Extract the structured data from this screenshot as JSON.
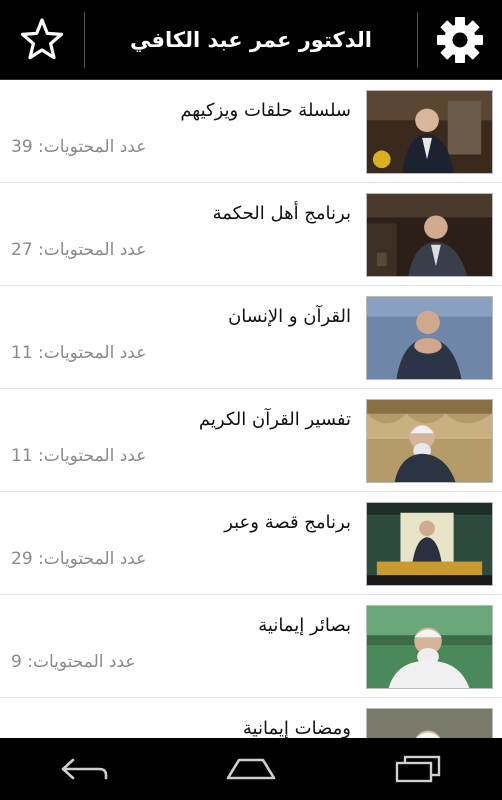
{
  "header": {
    "title": "الدكتور عمر عبد الكافي",
    "favorites_icon": "star-outline-icon",
    "settings_icon": "gear-icon"
  },
  "series": [
    {
      "title": "سلسلة حلقات ويزكيهم",
      "count_label": "عدد المحتويات: 39"
    },
    {
      "title": "برنامج أهل الحكمة",
      "count_label": "عدد المحتويات: 27"
    },
    {
      "title": "القرآن و الإنسان",
      "count_label": "عدد المحتويات: 11"
    },
    {
      "title": "تفسير القرآن الكريم",
      "count_label": "عدد المحتويات: 11"
    },
    {
      "title": "برنامج قصة وعبر",
      "count_label": "عدد المحتويات: 29"
    },
    {
      "title": "بصائر إيمانية",
      "count_label": "عدد المحتويات: 9"
    },
    {
      "title": "ومضات إيمانية",
      "count_label": ""
    }
  ],
  "navbar": {
    "back_icon": "back-arrow-icon",
    "home_icon": "home-icon",
    "recents_icon": "recent-apps-icon"
  },
  "colors": {
    "topbar": "#000000",
    "background": "#ffffff",
    "title_text": "#111111",
    "count_text": "#8a8a8a",
    "divider": "#e2e2e2"
  }
}
